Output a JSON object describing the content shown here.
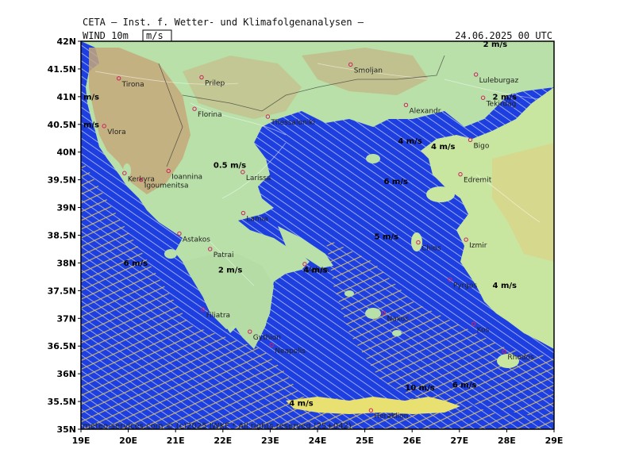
{
  "header": {
    "institute": "CETA — Inst. f. Wetter- und Klimafolgenanalysen —",
    "field_label": "WIND 10m",
    "unit_label": "m/s",
    "datetime": "24.06.2025 00 UTC"
  },
  "footer": {
    "copyright": "meteo-services.com © (c)2025 IWKF * All rights reserved (25+042)"
  },
  "axes": {
    "x_labels": [
      "19E",
      "20E",
      "21E",
      "22E",
      "23E",
      "24E",
      "25E",
      "26E",
      "27E",
      "28E",
      "29E"
    ],
    "y_labels": [
      "42N",
      "41.5N",
      "41N",
      "40.5N",
      "40N",
      "39.5N",
      "39N",
      "38.5N",
      "38N",
      "37.5N",
      "37N",
      "36.5N",
      "36N",
      "35.5N",
      "35N"
    ]
  },
  "cities": [
    {
      "name": "Tirona",
      "lon": 19.8,
      "lat": 41.33
    },
    {
      "name": "Prilep",
      "lon": 21.55,
      "lat": 41.35
    },
    {
      "name": "Smoljan",
      "lon": 24.7,
      "lat": 41.58
    },
    {
      "name": "Luleburgaz",
      "lon": 27.35,
      "lat": 41.4
    },
    {
      "name": "Tekirdag",
      "lon": 27.5,
      "lat": 40.98
    },
    {
      "name": "Florina",
      "lon": 21.4,
      "lat": 40.78
    },
    {
      "name": "Thessaloniki",
      "lon": 22.95,
      "lat": 40.64
    },
    {
      "name": "Alexandr.",
      "lon": 25.87,
      "lat": 40.85
    },
    {
      "name": "Vlora",
      "lon": 19.49,
      "lat": 40.47
    },
    {
      "name": "Bigo",
      "lon": 27.23,
      "lat": 40.22
    },
    {
      "name": "Kerkyra",
      "lon": 19.92,
      "lat": 39.62
    },
    {
      "name": "Ioannina",
      "lon": 20.85,
      "lat": 39.66
    },
    {
      "name": "Larissa",
      "lon": 22.42,
      "lat": 39.64
    },
    {
      "name": "Igoumenitsa",
      "lon": 20.27,
      "lat": 39.5
    },
    {
      "name": "Edremit",
      "lon": 27.02,
      "lat": 39.6
    },
    {
      "name": "Lamia",
      "lon": 22.43,
      "lat": 38.9
    },
    {
      "name": "Astakos",
      "lon": 21.08,
      "lat": 38.53
    },
    {
      "name": "Chios",
      "lon": 26.13,
      "lat": 38.37
    },
    {
      "name": "Izmir",
      "lon": 27.14,
      "lat": 38.42
    },
    {
      "name": "Patrai",
      "lon": 21.73,
      "lat": 38.25
    },
    {
      "name": "Athen",
      "lon": 23.73,
      "lat": 37.98
    },
    {
      "name": "Pyrgos",
      "lon": 26.8,
      "lat": 37.7
    },
    {
      "name": "Filiatra",
      "lon": 21.58,
      "lat": 37.16
    },
    {
      "name": "Gythion",
      "lon": 22.57,
      "lat": 36.76
    },
    {
      "name": "Naxos",
      "lon": 25.4,
      "lat": 37.1
    },
    {
      "name": "Rhodos",
      "lon": 27.95,
      "lat": 36.4
    },
    {
      "name": "Kos",
      "lon": 27.3,
      "lat": 36.9
    },
    {
      "name": "Neapolis",
      "lon": 23.03,
      "lat": 36.52
    },
    {
      "name": "Heraklion",
      "lon": 25.13,
      "lat": 35.34
    }
  ],
  "speed_labels": [
    {
      "text": "2 m/s",
      "lon": 27.5,
      "lat": 41.9
    },
    {
      "text": "2 m/s",
      "lon": 27.7,
      "lat": 40.95
    },
    {
      "text": "m/s",
      "lon": 19.05,
      "lat": 40.95
    },
    {
      "text": "m/s",
      "lon": 19.05,
      "lat": 40.45
    },
    {
      "text": "4 m/s",
      "lon": 25.7,
      "lat": 40.15
    },
    {
      "text": "4 m/s",
      "lon": 26.4,
      "lat": 40.05
    },
    {
      "text": "0.5 m/s",
      "lon": 21.8,
      "lat": 39.72
    },
    {
      "text": "6 m/s",
      "lon": 25.4,
      "lat": 39.42
    },
    {
      "text": "5 m/s",
      "lon": 25.2,
      "lat": 38.43
    },
    {
      "text": "6 m/s",
      "lon": 19.9,
      "lat": 37.95
    },
    {
      "text": "2 m/s",
      "lon": 21.9,
      "lat": 37.83
    },
    {
      "text": "4 m/s",
      "lon": 23.7,
      "lat": 37.83
    },
    {
      "text": "4 m/s",
      "lon": 27.7,
      "lat": 37.55
    },
    {
      "text": "10 m/s",
      "lon": 25.85,
      "lat": 35.7
    },
    {
      "text": "6 m/s",
      "lon": 26.85,
      "lat": 35.75
    },
    {
      "text": "4 m/s",
      "lon": 23.4,
      "lat": 35.42
    }
  ]
}
